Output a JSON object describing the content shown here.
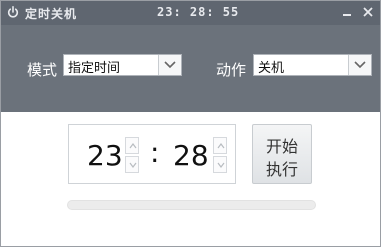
{
  "titlebar": {
    "title": "定时关机",
    "clock": "23: 28: 55",
    "icons": {
      "app": "power-icon",
      "minimize": "minimize-icon",
      "close": "close-icon"
    }
  },
  "mode": {
    "label": "模式",
    "value": "指定时间"
  },
  "action": {
    "label": "动作",
    "value": "关机"
  },
  "time": {
    "hour": "23",
    "separator": ":",
    "minute": "28"
  },
  "start_button": {
    "line1": "开始",
    "line2": "执行"
  },
  "progress": {
    "value": 0
  },
  "colors": {
    "titlebar_bg": "#5f6670",
    "header_bg": "#6b727b",
    "accent": "#7fb3e6"
  }
}
